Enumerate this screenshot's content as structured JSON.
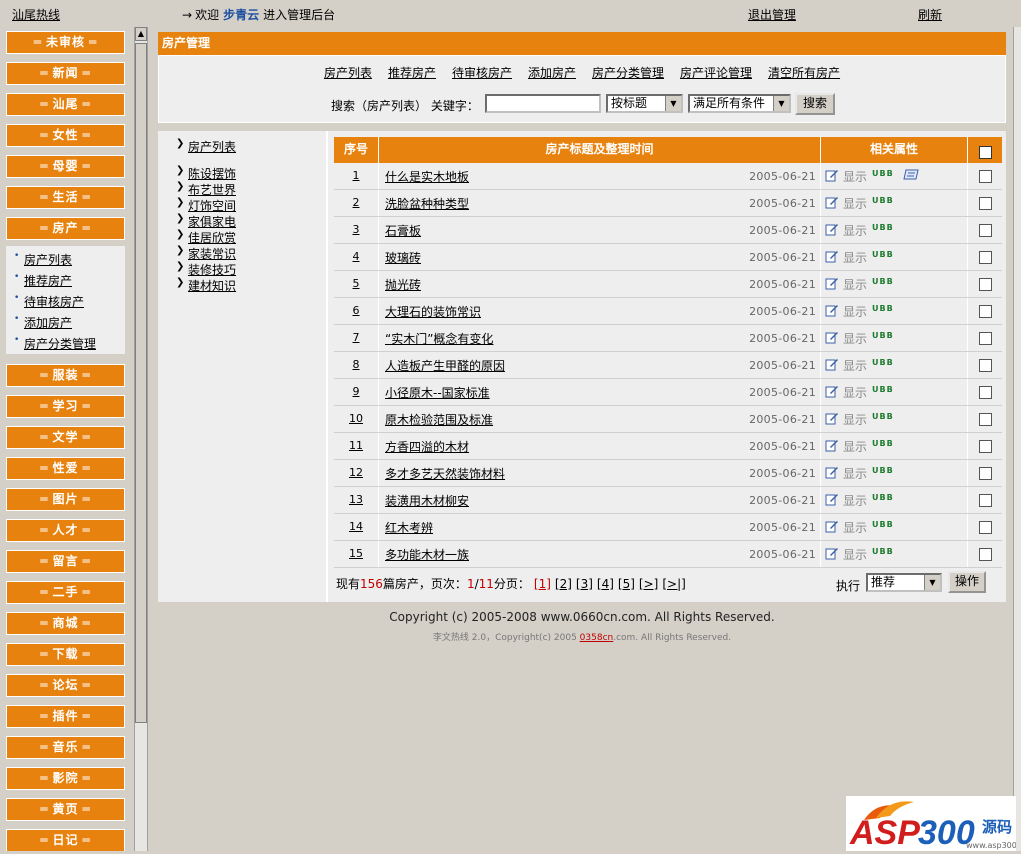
{
  "topbar": {
    "brand": "汕尾热线",
    "welcome_arrow": "→",
    "welcome_prefix": "欢迎",
    "user": "步青云",
    "welcome_suffix": "进入管理后台",
    "logout": "退出管理",
    "refresh": "刷新"
  },
  "sidebar": {
    "eq": "═",
    "categories_top": [
      "未审核",
      "新闻",
      "汕尾",
      "女性",
      "母婴",
      "生活",
      "房产"
    ],
    "sub_items": [
      "房产列表",
      "推荐房产",
      "待审核房产",
      "添加房产",
      "房产分类管理"
    ],
    "categories_bottom": [
      "服装",
      "学习",
      "文学",
      "性爱",
      "图片",
      "人才",
      "留言",
      "二手",
      "商城",
      "下载",
      "论坛",
      "插件",
      "音乐",
      "影院",
      "黄页",
      "日记"
    ]
  },
  "main": {
    "header": "房产管理",
    "nav": [
      "房产列表",
      "推荐房产",
      "待审核房产",
      "添加房产",
      "房产分类管理",
      "房产评论管理",
      "清空所有房产"
    ],
    "search": {
      "label": "搜索（房产列表） 关键字：",
      "value": "",
      "field_select": "按标题",
      "cond_select": "满足所有条件",
      "button": "搜索"
    }
  },
  "categories": [
    "房产列表",
    "陈设摆饰",
    "布艺世界",
    "灯饰空间",
    "家俱家电",
    "佳居欣赏",
    "家装常识",
    "装修技巧",
    "建材知识"
  ],
  "table": {
    "headers": {
      "no": "序号",
      "title": "房产标题及整理时间",
      "attr": "相关属性"
    },
    "show_label": "显示",
    "ubb_label": "UBB",
    "rows": [
      {
        "no": "1",
        "title": "什么是实木地板",
        "date": "2005-06-21"
      },
      {
        "no": "2",
        "title": "洗脸盆种种类型",
        "date": "2005-06-21"
      },
      {
        "no": "3",
        "title": "石膏板",
        "date": "2005-06-21"
      },
      {
        "no": "4",
        "title": "玻璃砖",
        "date": "2005-06-21"
      },
      {
        "no": "5",
        "title": "抛光砖",
        "date": "2005-06-21"
      },
      {
        "no": "6",
        "title": "大理石的装饰常识",
        "date": "2005-06-21"
      },
      {
        "no": "7",
        "title": "“实木门”概念有变化",
        "date": "2005-06-21"
      },
      {
        "no": "8",
        "title": "人造板产生甲醛的原因",
        "date": "2005-06-21"
      },
      {
        "no": "9",
        "title": "小径原木--国家标准",
        "date": "2005-06-21"
      },
      {
        "no": "10",
        "title": "原木检验范围及标准",
        "date": "2005-06-21"
      },
      {
        "no": "11",
        "title": "方香四溢的木材",
        "date": "2005-06-21"
      },
      {
        "no": "12",
        "title": "多才多艺天然装饰材料",
        "date": "2005-06-21"
      },
      {
        "no": "13",
        "title": "装潢用木材柳安",
        "date": "2005-06-21"
      },
      {
        "no": "14",
        "title": "红木考辨",
        "date": "2005-06-21"
      },
      {
        "no": "15",
        "title": "多功能木材一族",
        "date": "2005-06-21"
      }
    ]
  },
  "pager": {
    "prefix": "现有",
    "total": "156",
    "mid": "篇房产，页次：",
    "current": "1",
    "slash": "/",
    "pages_total": "11",
    "suffix": "分页：",
    "links": [
      "[1]",
      "[2]",
      "[3]",
      "[4]",
      "[5]",
      "[>]",
      "[>|]"
    ]
  },
  "actions": {
    "exec_label": "执行",
    "select": "推荐",
    "button": "操作"
  },
  "footer": {
    "copyright": "Copyright (c) 2005-2008 www.0660cn.com. All Rights Reserved.",
    "powered_prefix": "李文热线 2.0，Copyright(c) 2005",
    "powered_link_red": "0358cn",
    "powered_link_rest": ".com",
    "powered_suffix": ". All Rights Reserved."
  },
  "logo": {
    "text": "ASP300",
    "cn": "源码",
    "url": "www.asp300.com"
  },
  "colors": {
    "accent": "#e8820e",
    "panel": "#eeeeee",
    "bg": "#d4d0c8",
    "link_blue": "#1a4ea0",
    "red": "#c00000"
  }
}
